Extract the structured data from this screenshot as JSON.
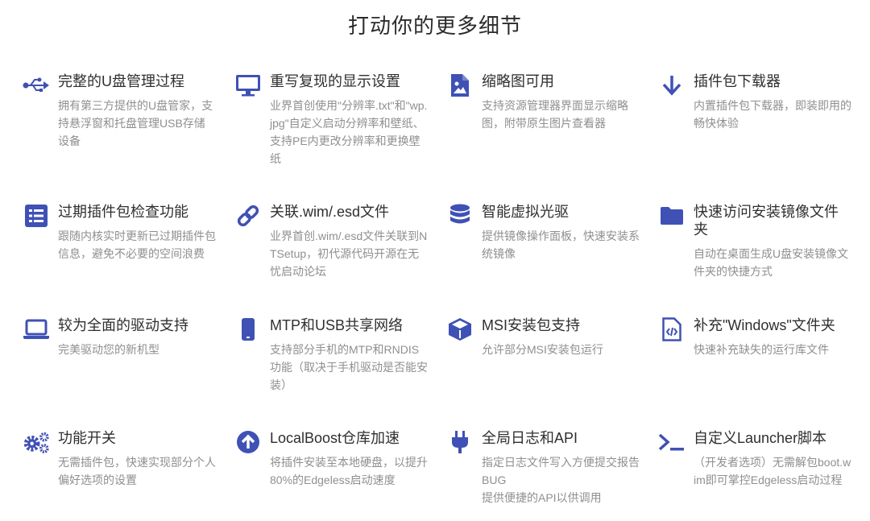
{
  "page": {
    "title": "打动你的更多细节"
  },
  "colors": {
    "icon": "#3f51b5",
    "title": "#2f2f2f",
    "desc": "#8f8f8f"
  },
  "features": [
    {
      "icon": "usb-icon",
      "title": "完整的U盘管理过程",
      "desc": "拥有第三方提供的U盘管家，支持悬浮窗和托盘管理USB存储设备"
    },
    {
      "icon": "monitor-icon",
      "title": "重写复现的显示设置",
      "desc": "业界首创使用\"分辨率.txt\"和\"wp.jpg\"自定义启动分辨率和壁纸、支持PE内更改分辨率和更换壁纸"
    },
    {
      "icon": "image-file-icon",
      "title": "缩略图可用",
      "desc": "支持资源管理器界面显示缩略图，附带原生图片查看器"
    },
    {
      "icon": "download-icon",
      "title": "插件包下载器",
      "desc": "内置插件包下载器，即装即用的畅快体验"
    },
    {
      "icon": "list-icon",
      "title": "过期插件包检查功能",
      "desc": "跟随内核实时更新已过期插件包信息，避免不必要的空间浪费"
    },
    {
      "icon": "link-icon",
      "title": "关联.wim/.esd文件",
      "desc": "业界首创.wim/.esd文件关联到NTSetup，初代源代码开源在无忧启动论坛"
    },
    {
      "icon": "database-icon",
      "title": "智能虚拟光驱",
      "desc": "提供镜像操作面板，快速安装系统镜像"
    },
    {
      "icon": "folder-icon",
      "title": "快速访问安装镜像文件夹",
      "desc": "自动在桌面生成U盘安装镜像文件夹的快捷方式"
    },
    {
      "icon": "laptop-icon",
      "title": "较为全面的驱动支持",
      "desc": "完美驱动您的新机型"
    },
    {
      "icon": "phone-icon",
      "title": "MTP和USB共享网络",
      "desc": "支持部分手机的MTP和RNDIS功能（取决于手机驱动是否能安装）"
    },
    {
      "icon": "package-icon",
      "title": "MSI安装包支持",
      "desc": "允许部分MSI安装包运行"
    },
    {
      "icon": "code-file-icon",
      "title": "补充\"Windows\"文件夹",
      "desc": "快速补充缺失的运行库文件"
    },
    {
      "icon": "gears-icon",
      "title": "功能开关",
      "desc": "无需插件包，快速实现部分个人偏好选项的设置"
    },
    {
      "icon": "arrow-up-circle-icon",
      "title": "LocalBoost仓库加速",
      "desc": "将插件安装至本地硬盘，以提升80%的Edgeless启动速度"
    },
    {
      "icon": "plug-icon",
      "title": "全局日志和API",
      "desc": "指定日志文件写入方便提交报告BUG\n提供便捷的API以供调用"
    },
    {
      "icon": "terminal-icon",
      "title": "自定义Launcher脚本",
      "desc": "（开发者选项）无需解包boot.wim即可掌控Edgeless启动过程"
    }
  ]
}
